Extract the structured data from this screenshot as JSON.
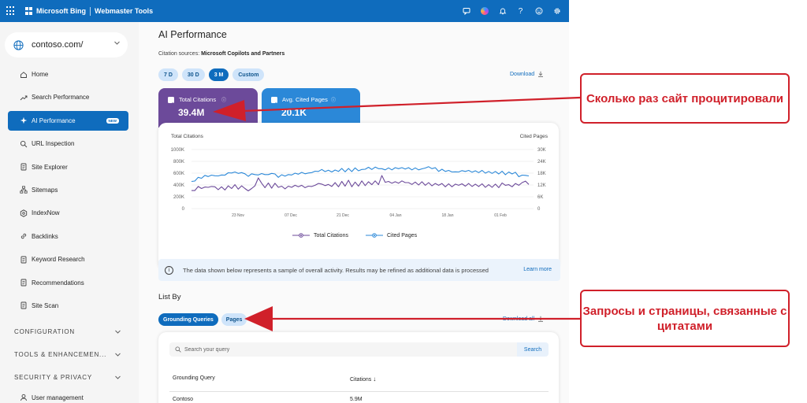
{
  "header": {
    "brand": "Microsoft Bing",
    "product": "Webmaster Tools",
    "icons": [
      "feedback-icon",
      "copilot-icon",
      "bell-icon",
      "help-icon",
      "smiley-icon",
      "gear-icon"
    ]
  },
  "sidebar": {
    "site": "contoso.com/",
    "items": [
      {
        "label": "Home",
        "icon": "home-icon"
      },
      {
        "label": "Search Performance",
        "icon": "trend-icon"
      },
      {
        "label": "AI Performance",
        "icon": "sparkle-icon",
        "active": true,
        "badge": "NEW"
      },
      {
        "label": "URL Inspection",
        "icon": "search-icon"
      },
      {
        "label": "Site Explorer",
        "icon": "document-icon"
      },
      {
        "label": "Sitemaps",
        "icon": "sitemap-icon"
      },
      {
        "label": "IndexNow",
        "icon": "indexnow-icon"
      },
      {
        "label": "Backlinks",
        "icon": "link-icon"
      },
      {
        "label": "Keyword Research",
        "icon": "document-icon"
      },
      {
        "label": "Recommendations",
        "icon": "document-icon"
      },
      {
        "label": "Site Scan",
        "icon": "document-icon"
      }
    ],
    "groups": [
      "CONFIGURATION",
      "TOOLS & ENHANCEMEN...",
      "SECURITY & PRIVACY"
    ],
    "user_management": "User management"
  },
  "main": {
    "title": "AI Performance",
    "citation_sources_label": "Citation sources:",
    "citation_sources_value": "Microsoft Copilots and Partners",
    "ranges": [
      "7 D",
      "30 D",
      "3 M",
      "Custom"
    ],
    "active_range": "3 M",
    "download": "Download",
    "metrics": [
      {
        "label": "Total Citations",
        "value": "39.4M",
        "color": "#6c4a9a"
      },
      {
        "label": "Avg. Cited Pages",
        "value": "20.1K",
        "color": "#2b88d8"
      }
    ],
    "notice": "The data shown below represents a sample of overall activity. Results may be refined as additional data is processed",
    "learn_more": "Learn more",
    "list_by": "List By",
    "tabs": [
      "Grounding Queries",
      "Pages"
    ],
    "download_all": "Download all",
    "search_placeholder": "Search your query",
    "search_button": "Search",
    "table": {
      "headers": [
        "Grounding Query",
        "Citations"
      ],
      "rows": [
        [
          "Contoso",
          "5.9M"
        ]
      ]
    }
  },
  "chart_data": {
    "type": "line",
    "left_axis_title": "Total Citations",
    "right_axis_title": "Cited Pages",
    "left_ticks": [
      "1000K",
      "800K",
      "600K",
      "400K",
      "200K",
      "0"
    ],
    "right_ticks": [
      "30K",
      "24K",
      "18K",
      "12K",
      "6K",
      "0"
    ],
    "left_ylim": [
      0,
      1000000
    ],
    "right_ylim": [
      0,
      30000
    ],
    "x_ticks": [
      "23 Nov",
      "07 Dec",
      "21 Dec",
      "04 Jan",
      "18 Jan",
      "01 Feb"
    ],
    "grid": true,
    "legend_position": "bottom",
    "series": [
      {
        "name": "Total Citations",
        "axis": "left",
        "color": "#6c4a9a",
        "values": [
          305000,
          305000,
          375000,
          340000,
          365000,
          360000,
          375000,
          370000,
          320000,
          370000,
          315000,
          385000,
          340000,
          405000,
          330000,
          385000,
          340000,
          300000,
          340000,
          385000,
          520000,
          430000,
          355000,
          435000,
          345000,
          430000,
          360000,
          380000,
          335000,
          380000,
          360000,
          395000,
          370000,
          395000,
          355000,
          380000,
          375000,
          395000,
          425000,
          415000,
          390000,
          410000,
          375000,
          440000,
          370000,
          460000,
          380000,
          480000,
          370000,
          450000,
          380000,
          470000,
          390000,
          455000,
          405000,
          470000,
          405000,
          560000,
          445000,
          460000,
          430000,
          455000,
          430000,
          470000,
          440000,
          440000,
          410000,
          450000,
          400000,
          455000,
          395000,
          440000,
          385000,
          425000,
          395000,
          425000,
          370000,
          420000,
          370000,
          415000,
          395000,
          420000,
          380000,
          425000,
          375000,
          415000,
          375000,
          420000,
          360000,
          405000,
          360000,
          415000,
          355000,
          435000,
          395000,
          405000,
          370000,
          425000,
          395000,
          440000,
          465000,
          410000
        ]
      },
      {
        "name": "Cited Pages",
        "axis": "right",
        "color": "#2b88d8",
        "values": [
          13800,
          14000,
          15900,
          15400,
          16900,
          16300,
          17000,
          16700,
          16600,
          17100,
          17000,
          18200,
          18100,
          18600,
          17900,
          18300,
          17700,
          16400,
          17700,
          17300,
          17100,
          17800,
          17300,
          17300,
          17900,
          17600,
          15900,
          17200,
          16500,
          17300,
          17100,
          18000,
          17500,
          18400,
          17700,
          18100,
          18300,
          19000,
          18900,
          19900,
          18800,
          19500,
          18600,
          19600,
          18900,
          20400,
          18700,
          20400,
          18800,
          20700,
          19200,
          19900,
          20000,
          21000,
          19900,
          21100,
          20300,
          20300,
          19700,
          20700,
          19700,
          20800,
          20300,
          20800,
          20100,
          20800,
          19700,
          20700,
          19700,
          20200,
          20600,
          21300,
          20300,
          20800,
          18900,
          20000,
          18900,
          19400,
          18600,
          18700,
          18600,
          19300,
          18900,
          19400,
          18500,
          19200,
          18300,
          19400,
          18000,
          18900,
          17900,
          18900,
          17600,
          19000,
          17200,
          18600,
          17600,
          18500,
          16200,
          17000,
          16900,
          16600
        ]
      }
    ]
  },
  "annotations": [
    {
      "text": "Сколько раз сайт процитировали",
      "color": "#d0202a"
    },
    {
      "text": "Запросы и страницы, связанные с цитатами",
      "color": "#d0202a"
    }
  ]
}
